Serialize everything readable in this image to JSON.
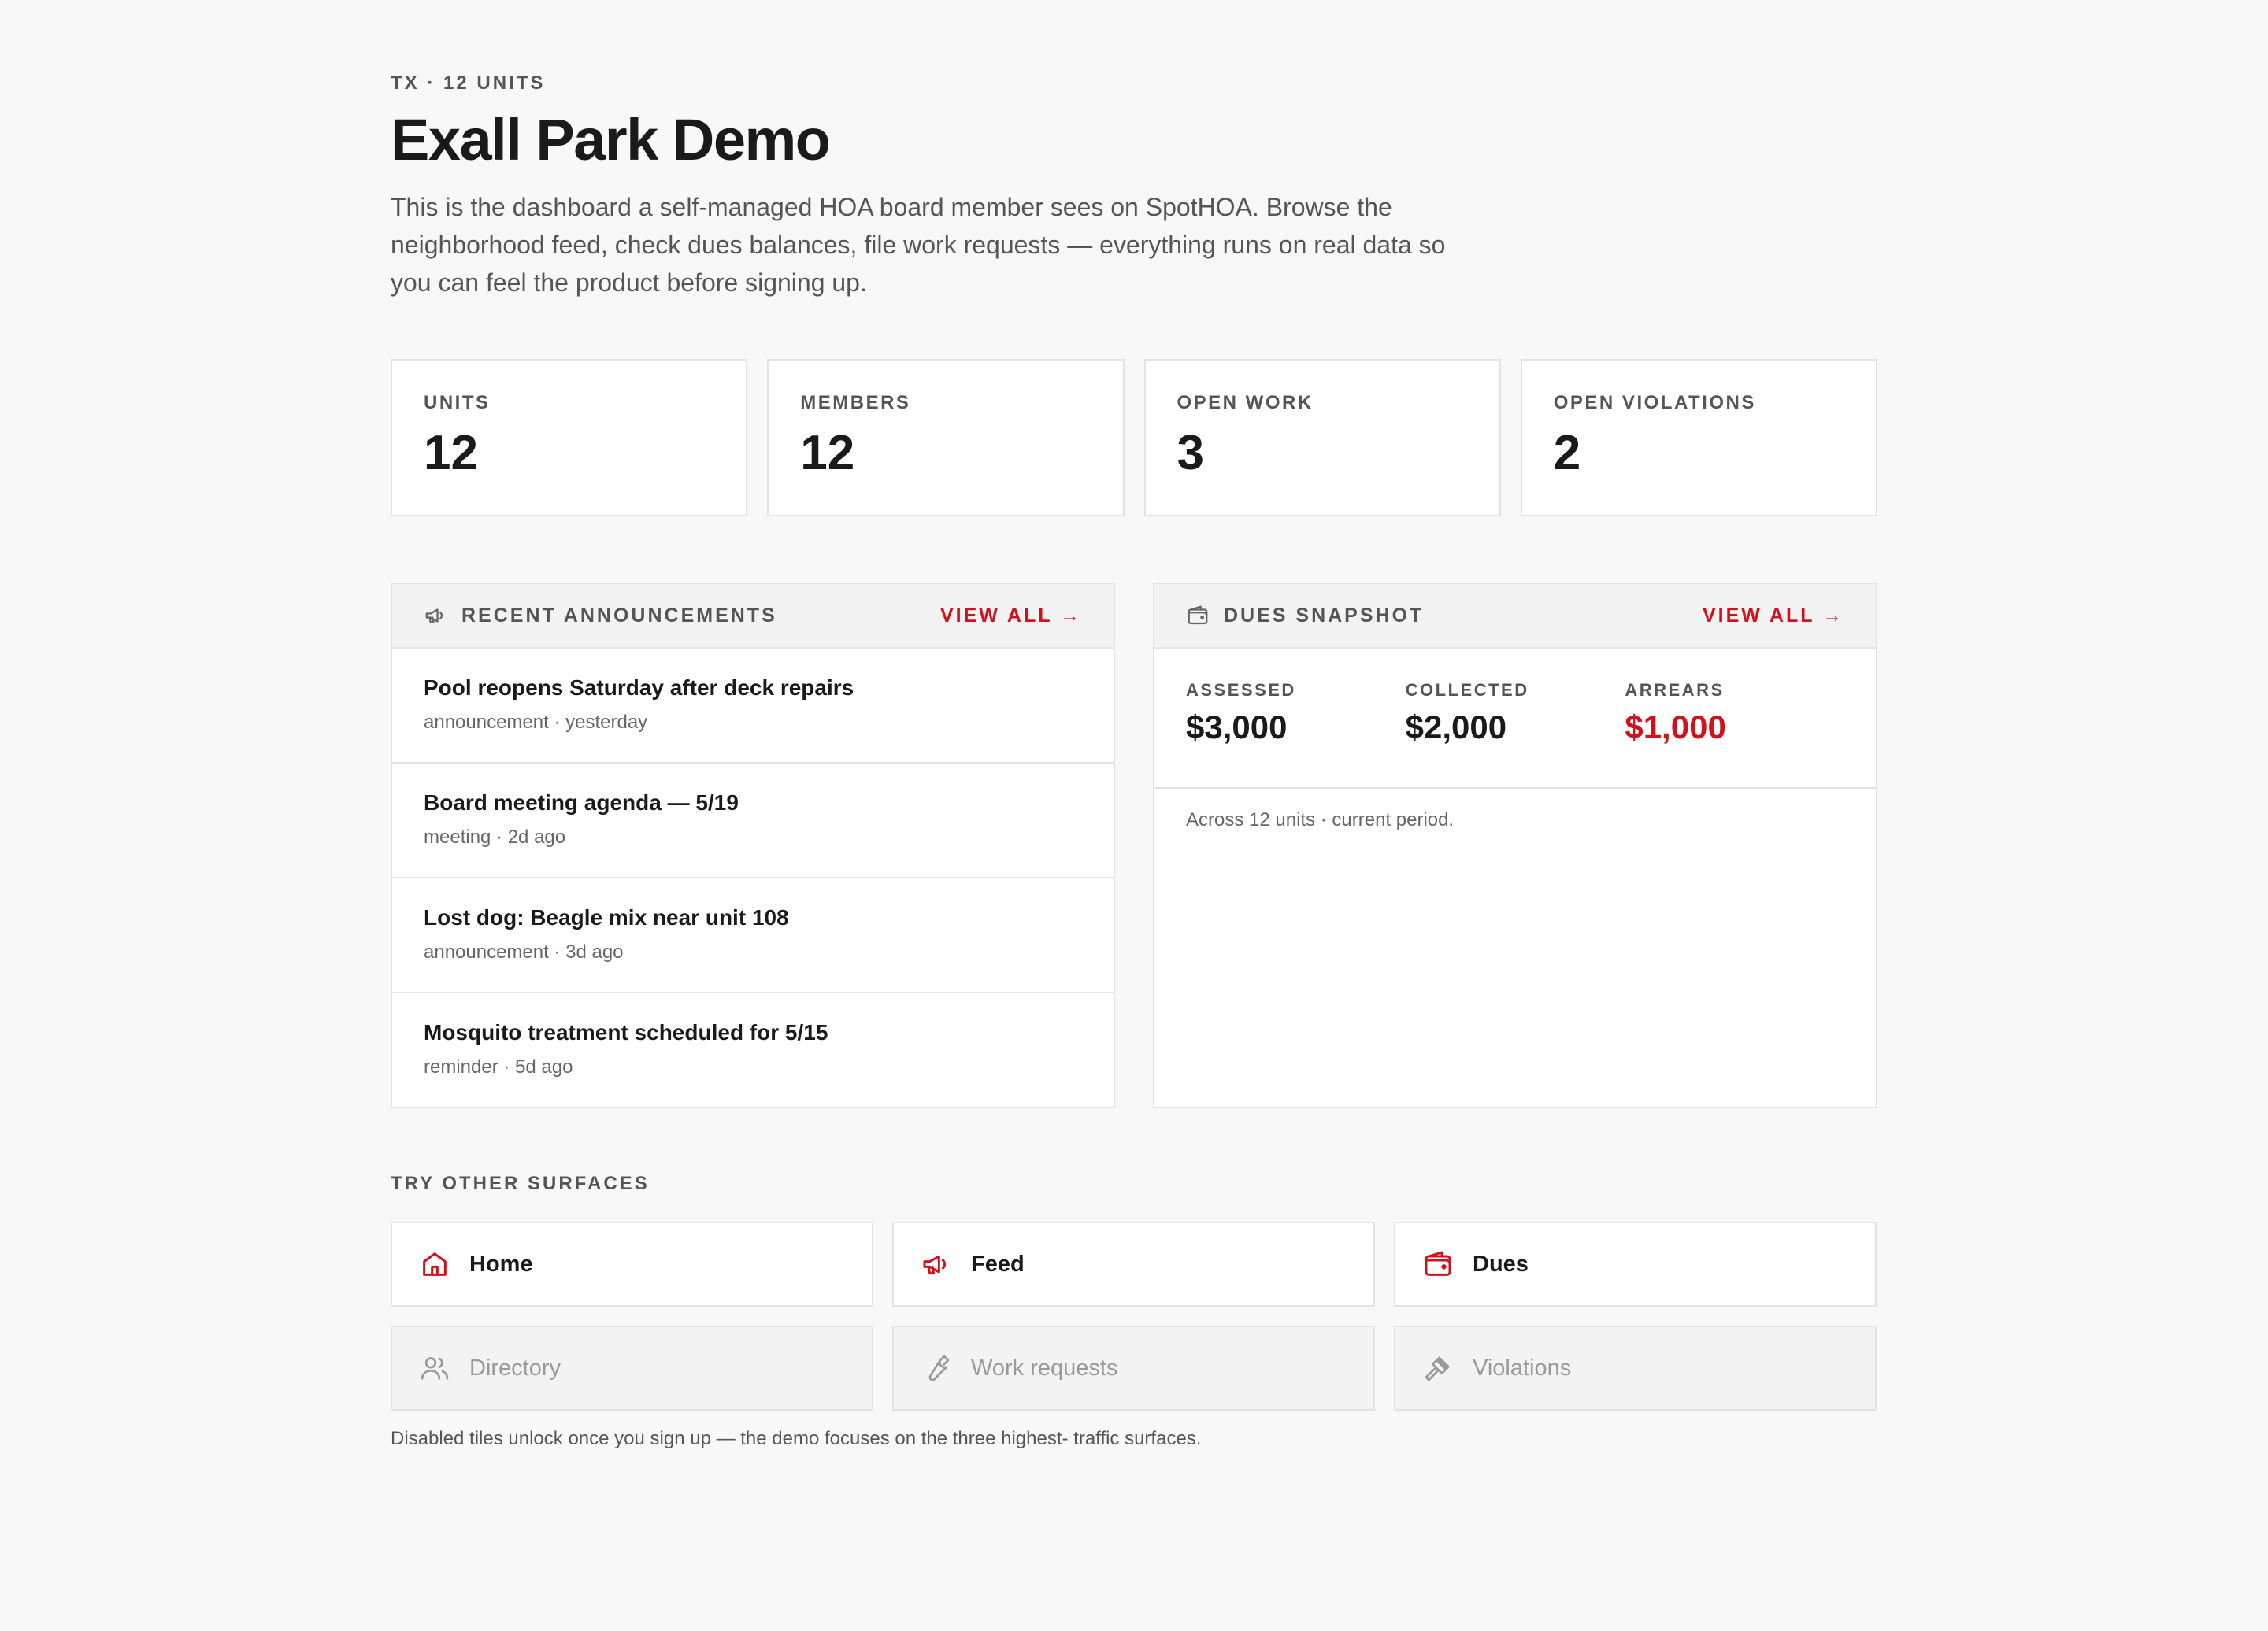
{
  "header": {
    "eyebrow": "TX · 12 UNITS",
    "title": "Exall Park Demo",
    "intro": "This is the dashboard a self-managed HOA board member sees on SpotHOA. Browse the neighborhood feed, check dues balances, file work requests — everything runs on real data so you can feel the product before signing up."
  },
  "stats": [
    {
      "label": "UNITS",
      "value": "12"
    },
    {
      "label": "MEMBERS",
      "value": "12"
    },
    {
      "label": "OPEN WORK",
      "value": "3"
    },
    {
      "label": "OPEN VIOLATIONS",
      "value": "2"
    }
  ],
  "announcements": {
    "icon": "megaphone-icon",
    "title": "RECENT ANNOUNCEMENTS",
    "view_all": "VIEW ALL →",
    "items": [
      {
        "title": "Pool reopens Saturday after deck repairs",
        "meta": "announcement · yesterday"
      },
      {
        "title": "Board meeting agenda — 5/19",
        "meta": "meeting · 2d ago"
      },
      {
        "title": "Lost dog: Beagle mix near unit 108",
        "meta": "announcement · 3d ago"
      },
      {
        "title": "Mosquito treatment scheduled for 5/15",
        "meta": "reminder · 5d ago"
      }
    ]
  },
  "dues": {
    "icon": "wallet-icon",
    "title": "DUES SNAPSHOT",
    "view_all": "VIEW ALL →",
    "assessed_label": "ASSESSED",
    "assessed_value": "$3,000",
    "collected_label": "COLLECTED",
    "collected_value": "$2,000",
    "arrears_label": "ARREARS",
    "arrears_value": "$1,000",
    "note": "Across 12 units · current period."
  },
  "surfaces": {
    "label": "TRY OTHER SURFACES",
    "tiles": [
      {
        "label": "Home",
        "icon": "home-icon",
        "enabled": true
      },
      {
        "label": "Feed",
        "icon": "megaphone-icon",
        "enabled": true
      },
      {
        "label": "Dues",
        "icon": "wallet-icon",
        "enabled": true
      },
      {
        "label": "Directory",
        "icon": "users-icon",
        "enabled": false
      },
      {
        "label": "Work requests",
        "icon": "wrench-icon",
        "enabled": false
      },
      {
        "label": "Violations",
        "icon": "gavel-icon",
        "enabled": false
      }
    ],
    "footnote": "Disabled tiles unlock once you sign up — the demo focuses on the three highest- traffic surfaces."
  },
  "colors": {
    "accent": "#d0121c",
    "background": "#f8f8f8",
    "border": "#e3e3e3",
    "muted_text": "#555555",
    "disabled_text": "#9a9a9a"
  }
}
